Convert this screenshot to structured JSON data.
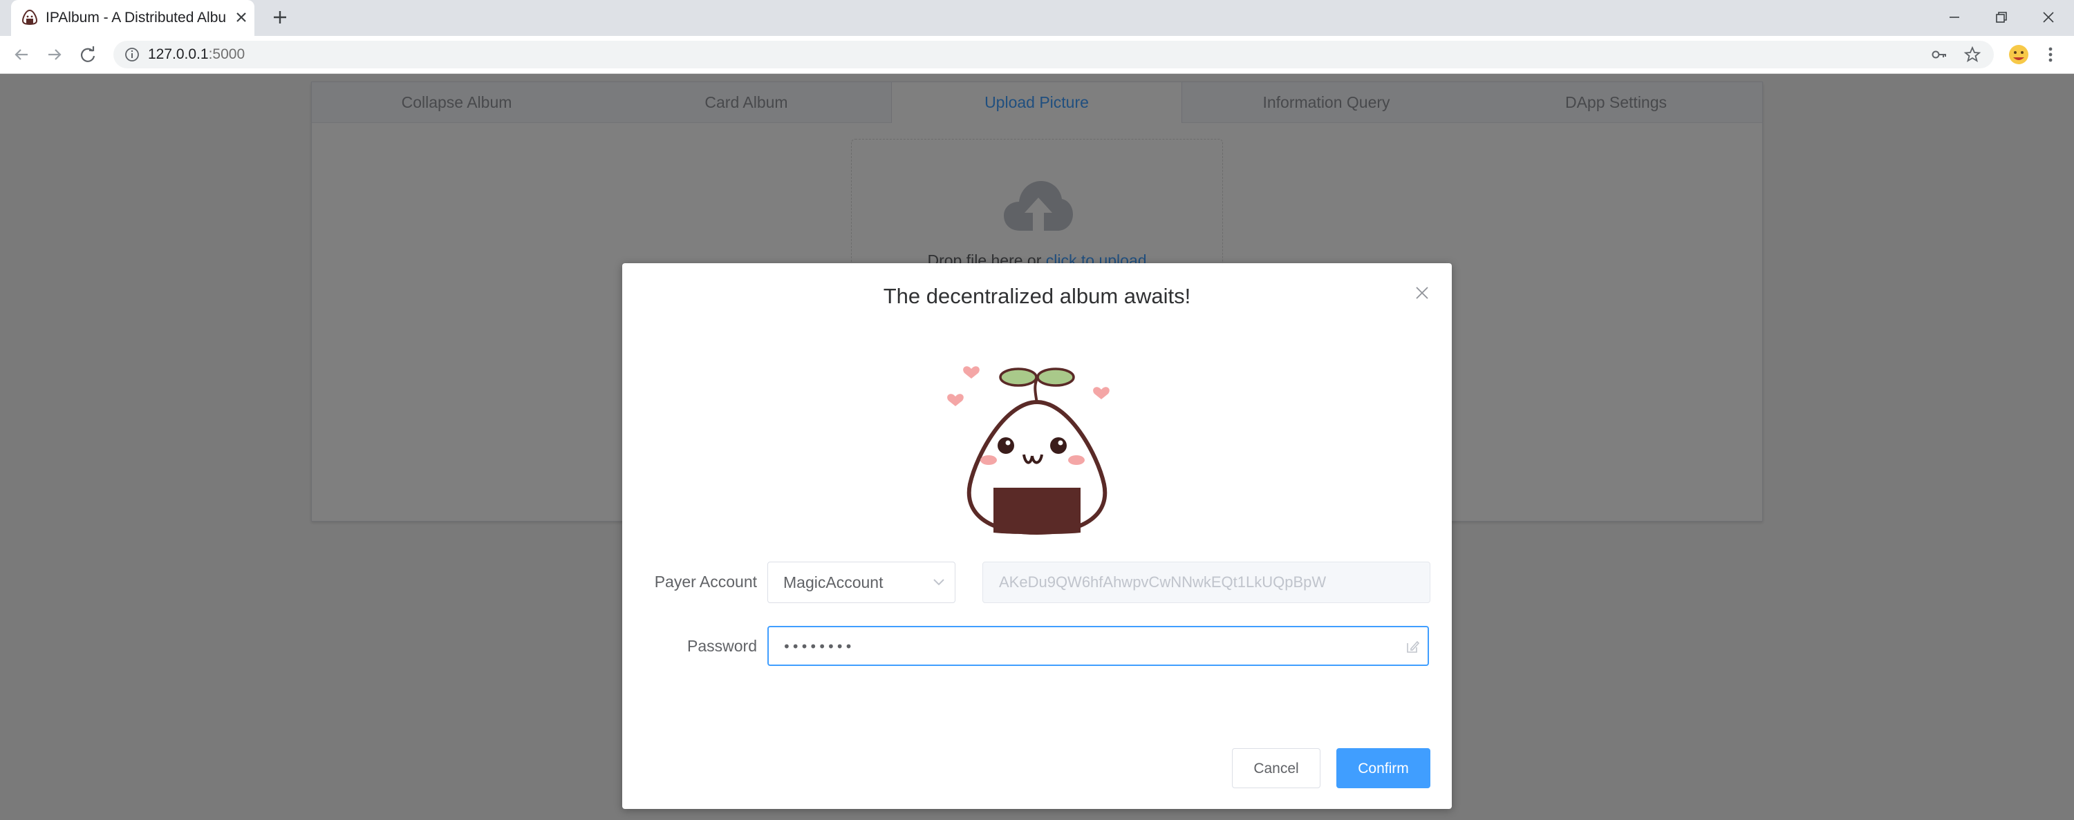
{
  "browser": {
    "tab_title": "IPAlbum - A Distributed Album",
    "url_host": "127.0.0.1",
    "url_port": ":5000"
  },
  "page": {
    "tabs": [
      {
        "label": "Collapse Album"
      },
      {
        "label": "Card Album"
      },
      {
        "label": "Upload Picture"
      },
      {
        "label": "Information Query"
      },
      {
        "label": "DApp Settings"
      }
    ],
    "active_tab": "Upload Picture",
    "upload": {
      "text": "Drop file here or ",
      "link": "click to upload"
    }
  },
  "dialog": {
    "title": "The decentralized album awaits!",
    "payer_label": "Payer Account",
    "payer_value": "MagicAccount",
    "payer_address": "AKeDu9QW6hfAhwpvCwNNwkEQt1LkUQpBpW",
    "password_label": "Password",
    "password_value": "MagicPwd",
    "cancel_label": "Cancel",
    "confirm_label": "Confirm"
  },
  "colors": {
    "primary": "#409eff",
    "mask": "rgba(0,0,0,0.5)",
    "chrome_bar": "#dee1e6"
  },
  "icons": {
    "tab_favicon": "onigiri-icon",
    "upload": "cloud-upload-icon",
    "password_edit": "edit-icon"
  }
}
